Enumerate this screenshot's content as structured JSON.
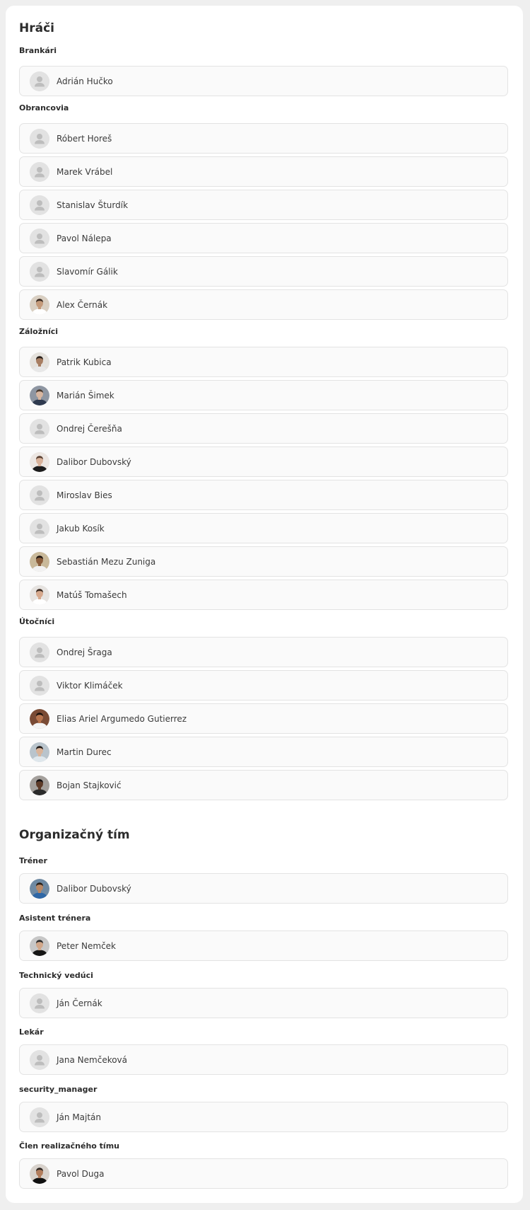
{
  "players": {
    "title": "Hráči",
    "groups": [
      {
        "label": "Brankári",
        "members": [
          {
            "name": "Adrián Hučko",
            "avatar": "placeholder"
          }
        ]
      },
      {
        "label": "Obrancovia",
        "members": [
          {
            "name": "Róbert Horeš",
            "avatar": "placeholder"
          },
          {
            "name": "Marek Vrábel",
            "avatar": "placeholder"
          },
          {
            "name": "Stanislav Šturdík",
            "avatar": "placeholder"
          },
          {
            "name": "Pavol Nálepa",
            "avatar": "placeholder"
          },
          {
            "name": "Slavomír Gálik",
            "avatar": "placeholder"
          },
          {
            "name": "Alex Černák",
            "avatar": "photo"
          }
        ]
      },
      {
        "label": "Záložníci",
        "members": [
          {
            "name": "Patrik Kubica",
            "avatar": "photo"
          },
          {
            "name": "Marián Šimek",
            "avatar": "photo"
          },
          {
            "name": "Ondrej Čerešňa",
            "avatar": "placeholder"
          },
          {
            "name": "Dalibor Dubovský",
            "avatar": "photo"
          },
          {
            "name": "Miroslav Bies",
            "avatar": "placeholder"
          },
          {
            "name": "Jakub Kosík",
            "avatar": "placeholder"
          },
          {
            "name": "Sebastián Mezu Zuniga",
            "avatar": "photo"
          },
          {
            "name": "Matúš Tomašech",
            "avatar": "photo"
          }
        ]
      },
      {
        "label": "Útočníci",
        "members": [
          {
            "name": "Ondrej Šraga",
            "avatar": "placeholder"
          },
          {
            "name": "Viktor Klimáček",
            "avatar": "placeholder"
          },
          {
            "name": "Elias Ariel Argumedo Gutierrez",
            "avatar": "photo"
          },
          {
            "name": "Martin Durec",
            "avatar": "photo"
          },
          {
            "name": "Bojan Stajković",
            "avatar": "photo"
          }
        ]
      }
    ]
  },
  "staff": {
    "title": "Organizačný tím",
    "groups": [
      {
        "label": "Tréner",
        "members": [
          {
            "name": "Dalibor Dubovský",
            "avatar": "photo"
          }
        ]
      },
      {
        "label": "Asistent trénera",
        "members": [
          {
            "name": "Peter Nemček",
            "avatar": "photo"
          }
        ]
      },
      {
        "label": "Technický vedúci",
        "members": [
          {
            "name": "Ján Černák",
            "avatar": "placeholder"
          }
        ]
      },
      {
        "label": "Lekár",
        "members": [
          {
            "name": "Jana Nemčeková",
            "avatar": "placeholder"
          }
        ]
      },
      {
        "label": "security_manager",
        "members": [
          {
            "name": "Ján Majtán",
            "avatar": "placeholder"
          }
        ]
      },
      {
        "label": "Člen realizačného tímu",
        "members": [
          {
            "name": "Pavol Duga",
            "avatar": "photo"
          }
        ]
      }
    ]
  },
  "theme": {
    "card_background": "#ffffff",
    "page_background": "#efefef",
    "row_background": "#fafafa",
    "row_border": "#e3e3e3",
    "placeholder_avatar": "#e2e2e2",
    "placeholder_icon": "#bdbdbd"
  }
}
